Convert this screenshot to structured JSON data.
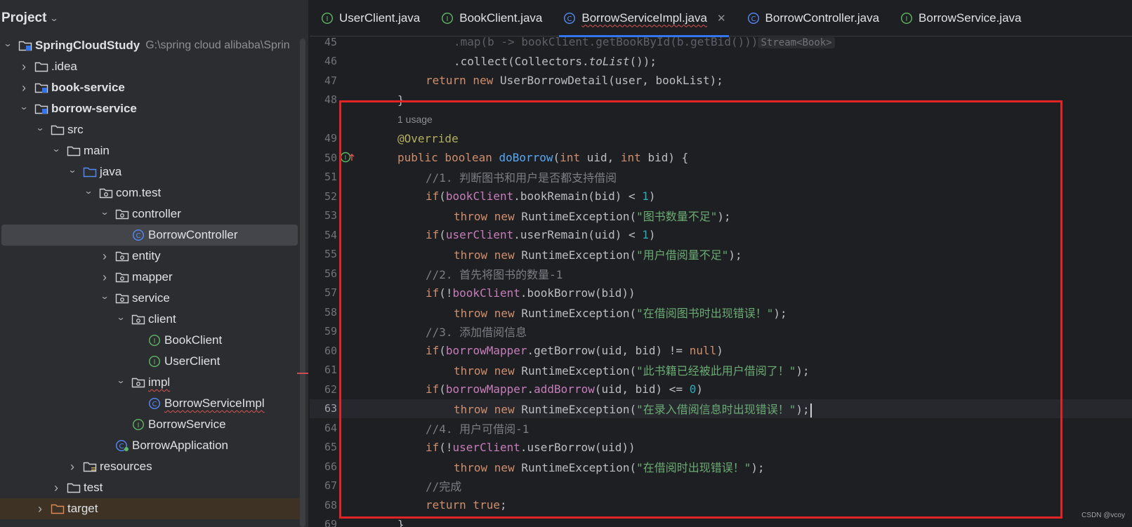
{
  "project_panel": {
    "title": "Project",
    "tree": [
      {
        "label": "SpringCloudStudy",
        "path": "G:\\spring cloud alibaba\\Sprin",
        "depth": 0,
        "arrow": "down",
        "icon": "module-folder-icon",
        "bold": true
      },
      {
        "label": ".idea",
        "depth": 1,
        "arrow": "right",
        "icon": "folder-icon"
      },
      {
        "label": "book-service",
        "depth": 1,
        "arrow": "right",
        "icon": "module-folder-icon",
        "bold": true
      },
      {
        "label": "borrow-service",
        "depth": 1,
        "arrow": "down",
        "icon": "module-folder-icon",
        "bold": true
      },
      {
        "label": "src",
        "depth": 2,
        "arrow": "down",
        "icon": "folder-icon"
      },
      {
        "label": "main",
        "depth": 3,
        "arrow": "down",
        "icon": "folder-icon"
      },
      {
        "label": "java",
        "depth": 4,
        "arrow": "down",
        "icon": "source-folder-icon"
      },
      {
        "label": "com.test",
        "depth": 5,
        "arrow": "down",
        "icon": "package-icon"
      },
      {
        "label": "controller",
        "depth": 6,
        "arrow": "down",
        "icon": "package-icon"
      },
      {
        "label": "BorrowController",
        "depth": 7,
        "arrow": "none",
        "icon": "class-icon",
        "selected": true
      },
      {
        "label": "entity",
        "depth": 6,
        "arrow": "right",
        "icon": "package-icon"
      },
      {
        "label": "mapper",
        "depth": 6,
        "arrow": "right",
        "icon": "package-icon"
      },
      {
        "label": "service",
        "depth": 6,
        "arrow": "down",
        "icon": "package-icon"
      },
      {
        "label": "client",
        "depth": 7,
        "arrow": "down",
        "icon": "package-icon"
      },
      {
        "label": "BookClient",
        "depth": 8,
        "arrow": "none",
        "icon": "interface-icon"
      },
      {
        "label": "UserClient",
        "depth": 8,
        "arrow": "none",
        "icon": "interface-icon"
      },
      {
        "label": "impl",
        "depth": 7,
        "arrow": "down",
        "icon": "package-icon",
        "squiggle": true
      },
      {
        "label": "BorrowServiceImpl",
        "depth": 8,
        "arrow": "none",
        "icon": "class-icon",
        "squiggle": true
      },
      {
        "label": "BorrowService",
        "depth": 7,
        "arrow": "none",
        "icon": "interface-icon"
      },
      {
        "label": "BorrowApplication",
        "depth": 6,
        "arrow": "none",
        "icon": "spring-app-icon"
      },
      {
        "label": "resources",
        "depth": 4,
        "arrow": "right",
        "icon": "resources-folder-icon"
      },
      {
        "label": "test",
        "depth": 3,
        "arrow": "right",
        "icon": "folder-icon"
      },
      {
        "label": "target",
        "depth": 2,
        "arrow": "right",
        "icon": "excluded-folder-icon",
        "highlight": true
      }
    ]
  },
  "tabs": [
    {
      "label": "UserClient.java",
      "icon": "interface-icon"
    },
    {
      "label": "BookClient.java",
      "icon": "interface-icon"
    },
    {
      "label": "BorrowServiceImpl.java",
      "icon": "class-icon",
      "active": true,
      "closable": true
    },
    {
      "label": "BorrowController.java",
      "icon": "class-icon"
    },
    {
      "label": "BorrowService.java",
      "icon": "interface-icon"
    }
  ],
  "editor": {
    "cursor_line": "63",
    "lines": [
      {
        "ln": "45",
        "indent": 12,
        "tokens": [
          {
            "t": ".map(b -> ",
            "c": "dim"
          },
          {
            "t": "bookClient.getBookById(b.getBid()))",
            "c": "dim"
          },
          {
            "t": "Stream<Book>",
            "c": "hint"
          }
        ]
      },
      {
        "ln": "46",
        "indent": 12,
        "tokens": [
          {
            "t": ".collect(Collectors."
          },
          {
            "t": "toList",
            "c": "itl"
          },
          {
            "t": "());"
          }
        ]
      },
      {
        "ln": "47",
        "indent": 8,
        "tokens": [
          {
            "t": "return new ",
            "c": "kw"
          },
          {
            "t": "UserBorrowDetail(user, bookList);"
          }
        ]
      },
      {
        "ln": "48",
        "indent": 4,
        "tokens": [
          {
            "t": "}"
          }
        ]
      },
      {
        "ln": "",
        "indent": 4,
        "usage": "1 usage"
      },
      {
        "ln": "49",
        "indent": 4,
        "tokens": [
          {
            "t": "@Override",
            "c": "ann"
          }
        ]
      },
      {
        "ln": "50",
        "indent": 4,
        "gutter": "implements-icon",
        "tokens": [
          {
            "t": "public boolean ",
            "c": "kw"
          },
          {
            "t": "doBorrow",
            "c": "fn"
          },
          {
            "t": "("
          },
          {
            "t": "int ",
            "c": "kw"
          },
          {
            "t": "uid, "
          },
          {
            "t": "int ",
            "c": "kw"
          },
          {
            "t": "bid) {"
          }
        ]
      },
      {
        "ln": "51",
        "indent": 8,
        "tokens": [
          {
            "t": "//1. 判断图书和用户是否都支持借阅",
            "c": "cmt"
          }
        ]
      },
      {
        "ln": "52",
        "indent": 8,
        "tokens": [
          {
            "t": "if",
            "c": "kw"
          },
          {
            "t": "("
          },
          {
            "t": "bookClient",
            "c": "fld"
          },
          {
            "t": ".bookRemain(bid) < "
          },
          {
            "t": "1",
            "c": "num"
          },
          {
            "t": ")"
          }
        ]
      },
      {
        "ln": "53",
        "indent": 12,
        "tokens": [
          {
            "t": "throw new ",
            "c": "kw"
          },
          {
            "t": "RuntimeException("
          },
          {
            "t": "\"图书数量不足\"",
            "c": "str"
          },
          {
            "t": ");"
          }
        ]
      },
      {
        "ln": "54",
        "indent": 8,
        "tokens": [
          {
            "t": "if",
            "c": "kw"
          },
          {
            "t": "("
          },
          {
            "t": "userClient",
            "c": "fld"
          },
          {
            "t": ".userRemain(uid) < "
          },
          {
            "t": "1",
            "c": "num"
          },
          {
            "t": ")"
          }
        ]
      },
      {
        "ln": "55",
        "indent": 12,
        "tokens": [
          {
            "t": "throw new ",
            "c": "kw"
          },
          {
            "t": "RuntimeException("
          },
          {
            "t": "\"用户借阅量不足\"",
            "c": "str"
          },
          {
            "t": ");"
          }
        ]
      },
      {
        "ln": "56",
        "indent": 8,
        "tokens": [
          {
            "t": "//2. 首先将图书的数量-1",
            "c": "cmt"
          }
        ]
      },
      {
        "ln": "57",
        "indent": 8,
        "tokens": [
          {
            "t": "if",
            "c": "kw"
          },
          {
            "t": "(!"
          },
          {
            "t": "bookClient",
            "c": "fld"
          },
          {
            "t": ".bookBorrow(bid))"
          }
        ]
      },
      {
        "ln": "58",
        "indent": 12,
        "tokens": [
          {
            "t": "throw new ",
            "c": "kw"
          },
          {
            "t": "RuntimeException("
          },
          {
            "t": "\"在借阅图书时出现错误！\"",
            "c": "str"
          },
          {
            "t": ");"
          }
        ]
      },
      {
        "ln": "59",
        "indent": 8,
        "tokens": [
          {
            "t": "//3. 添加借阅信息",
            "c": "cmt"
          }
        ]
      },
      {
        "ln": "60",
        "indent": 8,
        "tokens": [
          {
            "t": "if",
            "c": "kw"
          },
          {
            "t": "("
          },
          {
            "t": "borrowMapper",
            "c": "fld"
          },
          {
            "t": ".getBorrow(uid, bid) != "
          },
          {
            "t": "null",
            "c": "kw"
          },
          {
            "t": ")"
          }
        ]
      },
      {
        "ln": "61",
        "indent": 12,
        "tokens": [
          {
            "t": "throw new ",
            "c": "kw"
          },
          {
            "t": "RuntimeException("
          },
          {
            "t": "\"此书籍已经被此用户借阅了！\"",
            "c": "str"
          },
          {
            "t": ");"
          }
        ]
      },
      {
        "ln": "62",
        "indent": 8,
        "tokens": [
          {
            "t": "if",
            "c": "kw"
          },
          {
            "t": "("
          },
          {
            "t": "borrowMapper",
            "c": "fld"
          },
          {
            "t": "."
          },
          {
            "t": "addBorrow",
            "c": "fld"
          },
          {
            "t": "(uid, bid) <= "
          },
          {
            "t": "0",
            "c": "num"
          },
          {
            "t": ")"
          }
        ]
      },
      {
        "ln": "63",
        "indent": 12,
        "current": true,
        "tokens": [
          {
            "t": "throw new ",
            "c": "kw"
          },
          {
            "t": "RuntimeException("
          },
          {
            "t": "\"在录入借阅信息时出现错误！\"",
            "c": "str"
          },
          {
            "t": ");"
          }
        ]
      },
      {
        "ln": "64",
        "indent": 8,
        "tokens": [
          {
            "t": "//4. 用户可借阅-1",
            "c": "cmt"
          }
        ]
      },
      {
        "ln": "65",
        "indent": 8,
        "tokens": [
          {
            "t": "if",
            "c": "kw"
          },
          {
            "t": "(!"
          },
          {
            "t": "userClient",
            "c": "fld"
          },
          {
            "t": ".userBorrow(uid))"
          }
        ]
      },
      {
        "ln": "66",
        "indent": 12,
        "tokens": [
          {
            "t": "throw new ",
            "c": "kw"
          },
          {
            "t": "RuntimeException("
          },
          {
            "t": "\"在借阅时出现错误！\"",
            "c": "str"
          },
          {
            "t": ");"
          }
        ]
      },
      {
        "ln": "67",
        "indent": 8,
        "tokens": [
          {
            "t": "//完成",
            "c": "cmt"
          }
        ]
      },
      {
        "ln": "68",
        "indent": 8,
        "tokens": [
          {
            "t": "return true",
            "c": "kw"
          },
          {
            "t": ";"
          }
        ]
      },
      {
        "ln": "69",
        "indent": 4,
        "tokens": [
          {
            "t": "}"
          }
        ]
      }
    ]
  },
  "watermark": "CSDN @vcoy",
  "colors": {
    "annotation_box": "#e22424",
    "accent": "#3574f0"
  }
}
